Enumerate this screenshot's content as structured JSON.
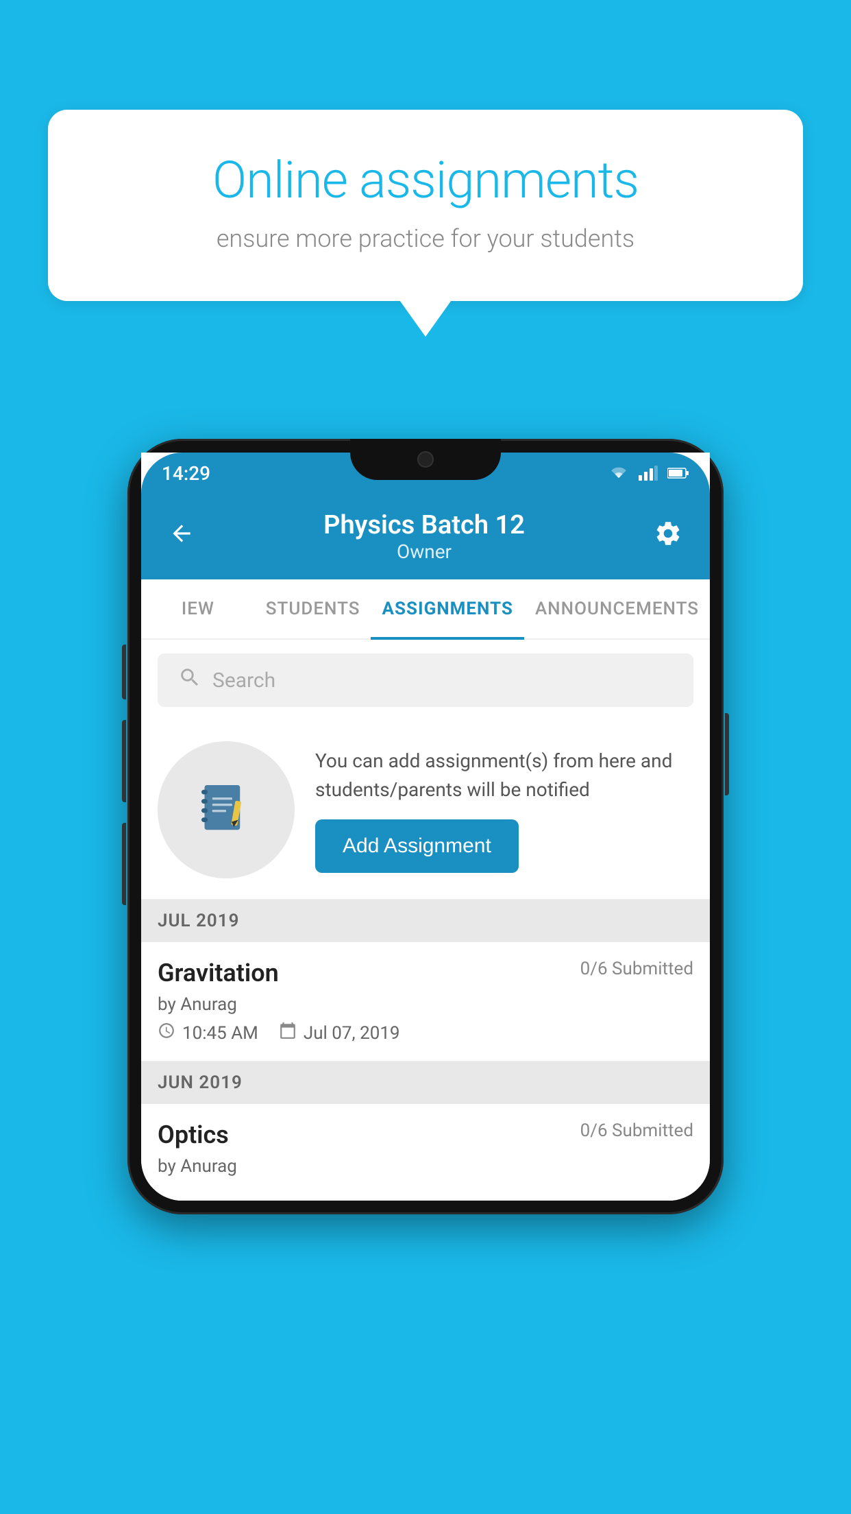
{
  "background_color": "#1ab8e8",
  "speech_bubble": {
    "title": "Online assignments",
    "subtitle": "ensure more practice for your students"
  },
  "phone": {
    "status_bar": {
      "time": "14:29",
      "wifi": "▼",
      "signal": "▲",
      "battery": "▐"
    },
    "header": {
      "title": "Physics Batch 12",
      "subtitle": "Owner",
      "back_label": "←",
      "settings_label": "⚙"
    },
    "tabs": [
      {
        "label": "IEW",
        "active": false
      },
      {
        "label": "STUDENTS",
        "active": false
      },
      {
        "label": "ASSIGNMENTS",
        "active": true
      },
      {
        "label": "ANNOUNCEMENTS",
        "active": false
      }
    ],
    "search": {
      "placeholder": "Search"
    },
    "promo": {
      "text": "You can add assignment(s) from here and students/parents will be notified",
      "button_label": "Add Assignment"
    },
    "sections": [
      {
        "month": "JUL 2019",
        "assignments": [
          {
            "name": "Gravitation",
            "submitted": "0/6 Submitted",
            "by": "by Anurag",
            "time": "10:45 AM",
            "date": "Jul 07, 2019"
          }
        ]
      },
      {
        "month": "JUN 2019",
        "assignments": [
          {
            "name": "Optics",
            "submitted": "0/6 Submitted",
            "by": "by Anurag",
            "time": "",
            "date": ""
          }
        ]
      }
    ]
  }
}
